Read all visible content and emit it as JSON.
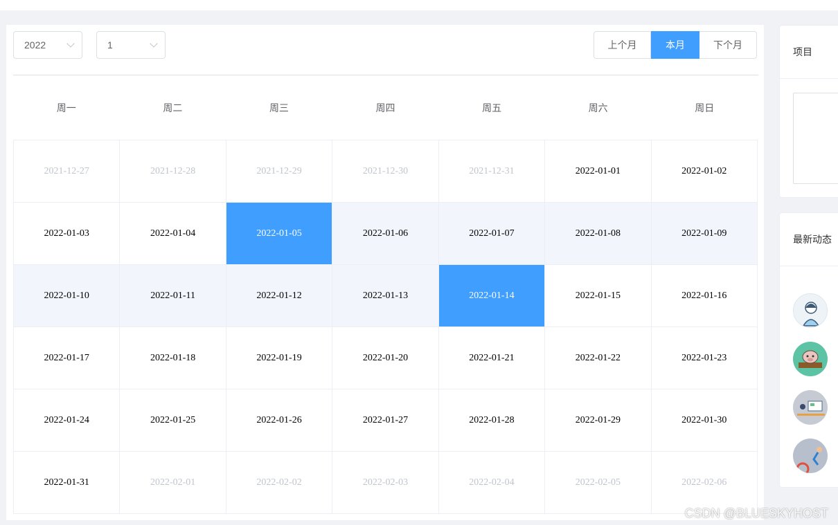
{
  "controls": {
    "year": "2022",
    "month": "1",
    "prev_label": "上个月",
    "current_label": "本月",
    "next_label": "下个月"
  },
  "weekdays": [
    "周一",
    "周二",
    "周三",
    "周四",
    "周五",
    "周六",
    "周日"
  ],
  "days": [
    {
      "date": "2021-12-27",
      "state": "other"
    },
    {
      "date": "2021-12-28",
      "state": "other"
    },
    {
      "date": "2021-12-29",
      "state": "other"
    },
    {
      "date": "2021-12-30",
      "state": "other"
    },
    {
      "date": "2021-12-31",
      "state": "other"
    },
    {
      "date": "2022-01-01",
      "state": "normal"
    },
    {
      "date": "2022-01-02",
      "state": "normal"
    },
    {
      "date": "2022-01-03",
      "state": "normal"
    },
    {
      "date": "2022-01-04",
      "state": "normal"
    },
    {
      "date": "2022-01-05",
      "state": "selected"
    },
    {
      "date": "2022-01-06",
      "state": "range"
    },
    {
      "date": "2022-01-07",
      "state": "range"
    },
    {
      "date": "2022-01-08",
      "state": "range"
    },
    {
      "date": "2022-01-09",
      "state": "range"
    },
    {
      "date": "2022-01-10",
      "state": "range"
    },
    {
      "date": "2022-01-11",
      "state": "range"
    },
    {
      "date": "2022-01-12",
      "state": "range"
    },
    {
      "date": "2022-01-13",
      "state": "range"
    },
    {
      "date": "2022-01-14",
      "state": "selected"
    },
    {
      "date": "2022-01-15",
      "state": "normal"
    },
    {
      "date": "2022-01-16",
      "state": "normal"
    },
    {
      "date": "2022-01-17",
      "state": "normal"
    },
    {
      "date": "2022-01-18",
      "state": "normal"
    },
    {
      "date": "2022-01-19",
      "state": "normal"
    },
    {
      "date": "2022-01-20",
      "state": "normal"
    },
    {
      "date": "2022-01-21",
      "state": "normal"
    },
    {
      "date": "2022-01-22",
      "state": "normal"
    },
    {
      "date": "2022-01-23",
      "state": "normal"
    },
    {
      "date": "2022-01-24",
      "state": "normal"
    },
    {
      "date": "2022-01-25",
      "state": "normal"
    },
    {
      "date": "2022-01-26",
      "state": "normal"
    },
    {
      "date": "2022-01-27",
      "state": "normal"
    },
    {
      "date": "2022-01-28",
      "state": "normal"
    },
    {
      "date": "2022-01-29",
      "state": "normal"
    },
    {
      "date": "2022-01-30",
      "state": "normal"
    },
    {
      "date": "2022-01-31",
      "state": "normal"
    },
    {
      "date": "2022-02-01",
      "state": "other"
    },
    {
      "date": "2022-02-02",
      "state": "other"
    },
    {
      "date": "2022-02-03",
      "state": "other"
    },
    {
      "date": "2022-02-04",
      "state": "other"
    },
    {
      "date": "2022-02-05",
      "state": "other"
    },
    {
      "date": "2022-02-06",
      "state": "other"
    }
  ],
  "sidebar": {
    "project_title": "项目",
    "activity_title": "最新动态",
    "avatars": [
      "avatar-girl-icon",
      "avatar-pig-icon",
      "avatar-desk-icon",
      "avatar-runner-icon"
    ]
  },
  "watermark": "CSDN @BLUESKYHOST",
  "colors": {
    "accent": "#409eff",
    "range_bg": "#f2f6fc",
    "other_text": "#c0c4cc",
    "page_bg": "#f0f2f5"
  }
}
